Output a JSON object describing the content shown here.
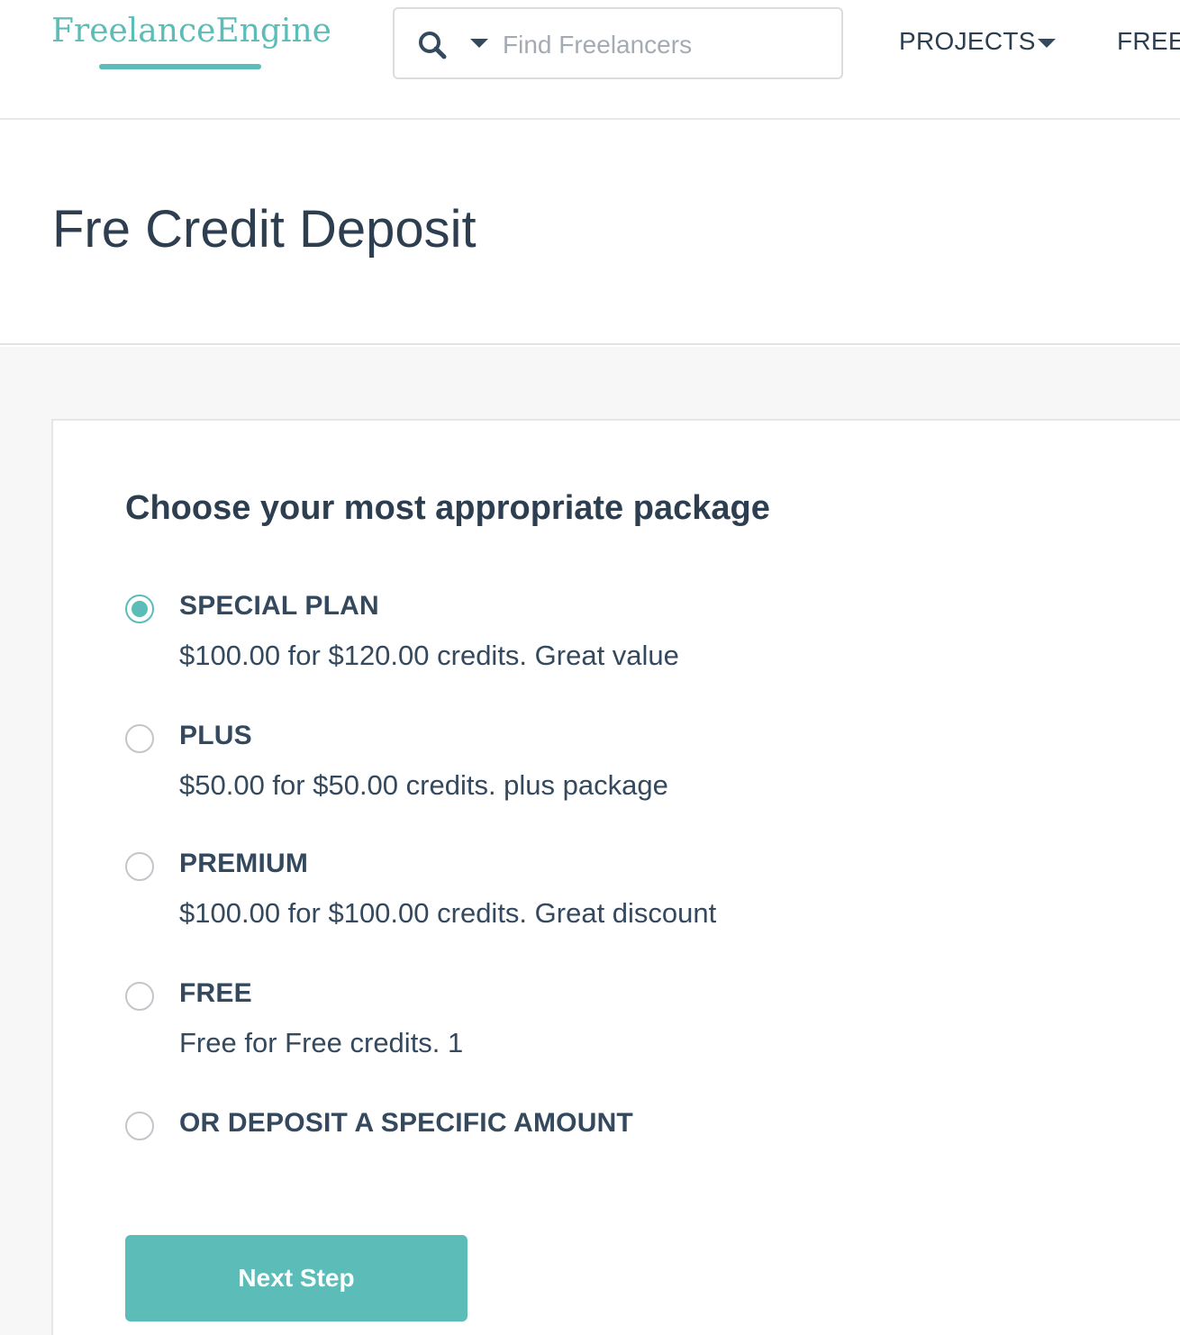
{
  "header": {
    "logo_text": "FreelanceEngine",
    "search": {
      "placeholder": "Find Freelancers",
      "value": ""
    },
    "nav": {
      "projects_label": "PROJECTS",
      "freelancers_label": "FREE"
    }
  },
  "page": {
    "title": "Fre Credit Deposit"
  },
  "form": {
    "heading": "Choose your most appropriate package",
    "selected": "SPECIAL PLAN",
    "packages": [
      {
        "name": "SPECIAL PLAN",
        "description": "$100.00 for $120.00 credits. Great value",
        "checked": true
      },
      {
        "name": "PLUS",
        "description": "$50.00 for $50.00 credits. plus package",
        "checked": false
      },
      {
        "name": "PREMIUM",
        "description": "$100.00 for $100.00 credits. Great discount",
        "checked": false
      },
      {
        "name": "FREE",
        "description": "Free for Free credits. 1",
        "checked": false
      },
      {
        "name": "OR DEPOSIT A SPECIFIC AMOUNT",
        "description": "",
        "checked": false
      }
    ],
    "next_label": "Next Step"
  },
  "colors": {
    "accent": "#5bbcb8",
    "text": "#2c3e50",
    "background": "#f7f7f7"
  },
  "icons": {
    "search": "search-icon",
    "dropdown": "caret-down-icon",
    "radio_selected": "radio-checked-icon",
    "radio_unselected": "radio-unchecked-icon"
  }
}
